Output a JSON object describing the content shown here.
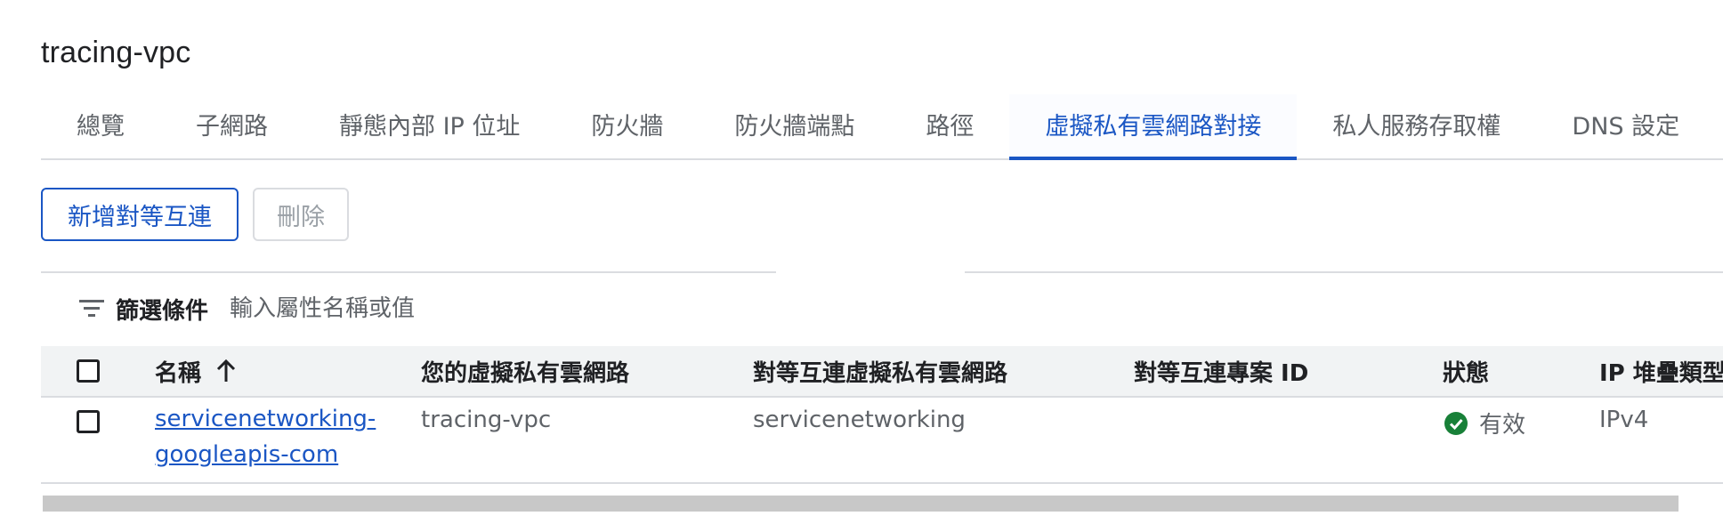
{
  "page": {
    "title": "tracing-vpc"
  },
  "tabs": [
    {
      "label": "總覽"
    },
    {
      "label": "子網路"
    },
    {
      "label": "靜態內部 IP 位址"
    },
    {
      "label": "防火牆"
    },
    {
      "label": "防火牆端點"
    },
    {
      "label": "路徑"
    },
    {
      "label": "虛擬私有雲網路對接",
      "active": true
    },
    {
      "label": "私人服務存取權"
    },
    {
      "label": "DNS 設定"
    }
  ],
  "toolbar": {
    "add_label": "新增對等互連",
    "delete_label": "刪除"
  },
  "filter": {
    "label": "篩選條件",
    "placeholder": "輸入屬性名稱或值"
  },
  "table": {
    "columns": [
      "名稱",
      "您的虛擬私有雲網路",
      "對等互連虛擬私有雲網路",
      "對等互連專案 ID",
      "狀態",
      "IP 堆疊類型"
    ],
    "rows": [
      {
        "name": "servicenetworking-googleapis-com",
        "your_vpc": "tracing-vpc",
        "peer_vpc": "servicenetworking",
        "peer_project_id": "",
        "status": "有效",
        "ip_stack": "IPv4"
      }
    ]
  },
  "colors": {
    "accent": "#1a56c4",
    "status_ok": "#188038"
  },
  "icons": {
    "filter": "filter-icon",
    "sort": "arrow-up-icon",
    "status": "check-circle-icon"
  }
}
